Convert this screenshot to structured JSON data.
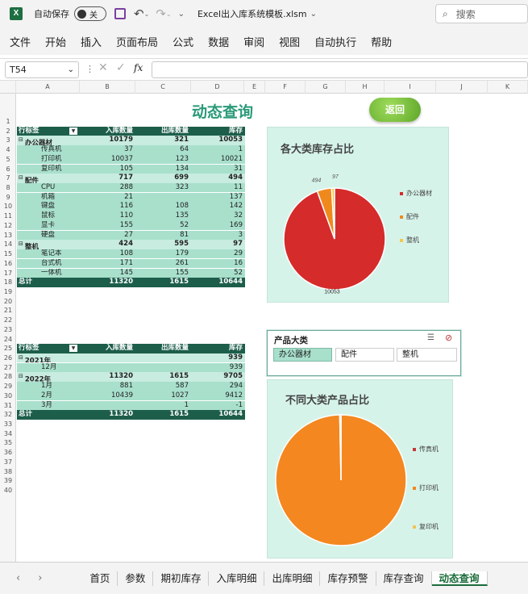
{
  "titlebar": {
    "autosave_label": "自动保存",
    "toggle_state": "关",
    "filename": "Excel出入库系统模板.xlsm",
    "search_placeholder": "搜索"
  },
  "menu": [
    "文件",
    "开始",
    "插入",
    "页面布局",
    "公式",
    "数据",
    "审阅",
    "视图",
    "自动执行",
    "帮助"
  ],
  "formula": {
    "name_box": "T54",
    "fx": "fx",
    "value": ""
  },
  "columns": [
    "A",
    "B",
    "C",
    "D",
    "E",
    "F",
    "G",
    "H",
    "I",
    "J",
    "K"
  ],
  "rows": [
    "1",
    "2",
    "3",
    "4",
    "5",
    "6",
    "7",
    "8",
    "9",
    "10",
    "11",
    "12",
    "13",
    "14",
    "15",
    "16",
    "17",
    "18",
    "19",
    "20",
    "21",
    "22",
    "23",
    "24",
    "25",
    "26",
    "27",
    "28",
    "29",
    "30",
    "31",
    "32",
    "33",
    "34",
    "35",
    "36",
    "37",
    "38",
    "39",
    "40"
  ],
  "sheet_title": "动态查询",
  "back_button": "返回",
  "pivot1": {
    "headers": [
      "行标签",
      "入库数量",
      "出库数量",
      "库存"
    ],
    "rows": [
      {
        "type": "group",
        "label": "办公器材",
        "v": [
          "10179",
          "321",
          "10053"
        ]
      },
      {
        "type": "leaf",
        "label": "传真机",
        "v": [
          "37",
          "64",
          "1"
        ]
      },
      {
        "type": "leaf",
        "label": "打印机",
        "v": [
          "10037",
          "123",
          "10021"
        ]
      },
      {
        "type": "leaf",
        "label": "复印机",
        "v": [
          "105",
          "134",
          "31"
        ]
      },
      {
        "type": "group",
        "label": "配件",
        "v": [
          "717",
          "699",
          "494"
        ]
      },
      {
        "type": "leaf",
        "label": "CPU",
        "v": [
          "288",
          "323",
          "11"
        ]
      },
      {
        "type": "leaf",
        "label": "机箱",
        "v": [
          "21",
          "",
          "137"
        ]
      },
      {
        "type": "leaf",
        "label": "键盘",
        "v": [
          "116",
          "108",
          "142"
        ]
      },
      {
        "type": "leaf",
        "label": "鼠标",
        "v": [
          "110",
          "135",
          "32"
        ]
      },
      {
        "type": "leaf",
        "label": "显卡",
        "v": [
          "155",
          "52",
          "169"
        ]
      },
      {
        "type": "leaf",
        "label": "硬盘",
        "v": [
          "27",
          "81",
          "3"
        ]
      },
      {
        "type": "group",
        "label": "整机",
        "v": [
          "424",
          "595",
          "97"
        ]
      },
      {
        "type": "leaf",
        "label": "笔记本",
        "v": [
          "108",
          "179",
          "29"
        ]
      },
      {
        "type": "leaf",
        "label": "台式机",
        "v": [
          "171",
          "261",
          "16"
        ]
      },
      {
        "type": "leaf",
        "label": "一体机",
        "v": [
          "145",
          "155",
          "52"
        ]
      },
      {
        "type": "total",
        "label": "总计",
        "v": [
          "11320",
          "1615",
          "10644"
        ]
      }
    ]
  },
  "pivot2": {
    "headers": [
      "行标签",
      "入库数量",
      "出库数量",
      "库存"
    ],
    "rows": [
      {
        "type": "group",
        "label": "2021年",
        "v": [
          "",
          "",
          "939"
        ]
      },
      {
        "type": "leaf",
        "label": "12月",
        "v": [
          "",
          "",
          "939"
        ]
      },
      {
        "type": "group",
        "label": "2022年",
        "v": [
          "11320",
          "1615",
          "9705"
        ]
      },
      {
        "type": "leaf",
        "label": "1月",
        "v": [
          "881",
          "587",
          "294"
        ]
      },
      {
        "type": "leaf",
        "label": "2月",
        "v": [
          "10439",
          "1027",
          "9412"
        ]
      },
      {
        "type": "leaf",
        "label": "3月",
        "v": [
          "",
          "1",
          "-1"
        ]
      },
      {
        "type": "total",
        "label": "总计",
        "v": [
          "11320",
          "1615",
          "10644"
        ]
      }
    ]
  },
  "slicer": {
    "title": "产品大类",
    "items": [
      "办公器材",
      "配件",
      "整机"
    ],
    "selected": 0
  },
  "colors": {
    "red": "#d52b2b",
    "orange": "#f0891d",
    "yellow": "#f3c84a",
    "chart_bg": "#d6f3ea",
    "pivot_header": "#1d5e4b"
  },
  "chart_data": [
    {
      "type": "pie",
      "title": "各大类库存占比",
      "categories": [
        "办公器材",
        "配件",
        "整机"
      ],
      "values": [
        10053,
        494,
        97
      ],
      "data_labels": [
        "10053",
        "494",
        "97"
      ],
      "colors": [
        "#d52b2b",
        "#f0891d",
        "#f3c84a"
      ],
      "legend": "right"
    },
    {
      "type": "pie",
      "title": "不同大类产品占比",
      "categories": [
        "传真机",
        "打印机",
        "复印机"
      ],
      "values": [
        1,
        10021,
        31
      ],
      "colors": [
        "#c43a3a",
        "#f4871f",
        "#f1c357"
      ],
      "legend": "right"
    }
  ],
  "tabs": [
    "首页",
    "参数",
    "期初库存",
    "入库明细",
    "出库明细",
    "库存预警",
    "库存查询",
    "动态查询"
  ],
  "active_tab": 7
}
